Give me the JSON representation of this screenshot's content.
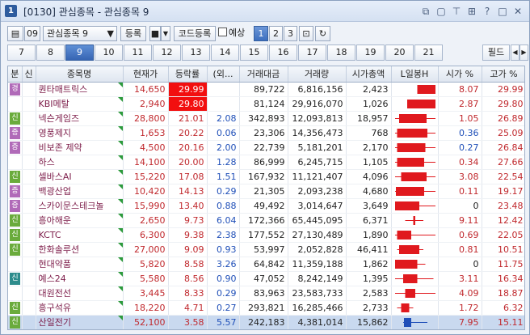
{
  "window": {
    "icon": "1",
    "title": "[0130] 관심종목 - 관심종목 9",
    "buttons": [
      "restore-icon",
      "minimize-icon",
      "pin-icon",
      "grid-icon",
      "help-icon",
      "maximize-icon",
      "close-icon"
    ]
  },
  "toolbar": {
    "group_number": "09",
    "group_name": "관심종목 9",
    "register": "등록",
    "code_register": "코드등록",
    "forecast": "예상",
    "pages": [
      "1",
      "2",
      "3"
    ],
    "active_page": "1"
  },
  "tabs": [
    "7",
    "8",
    "9",
    "10",
    "11",
    "12",
    "13",
    "14",
    "15",
    "16",
    "17",
    "18",
    "19",
    "20",
    "21"
  ],
  "active_tab": "9",
  "field_button": "필드",
  "columns": [
    "분",
    "신",
    "종목명",
    "현재가",
    "등락률",
    "(외...",
    "거래대금",
    "거래량",
    "시가총액",
    "L일봉H",
    "시가 %",
    "고가 %"
  ],
  "colors": {
    "up": "#c0282d",
    "down": "#1f4fb8",
    "hot": "#f20f0f",
    "badge_green": "#6aab3c",
    "badge_purple": "#b06ab8"
  },
  "rows": [
    {
      "badge": "경",
      "badge_color": "p",
      "name": "퀀타매트릭스",
      "price": "14,650",
      "rate": "29.99",
      "hot": true,
      "foreign": "",
      "amount": "89,722",
      "volume": "6,816,156",
      "cap": "2,423",
      "open": "8.07",
      "high": "29.99",
      "open_dir": "up",
      "high_dir": "up",
      "candle": [
        0.55,
        1.0,
        0.55,
        1.0
      ]
    },
    {
      "badge": "",
      "badge_color": "",
      "name": "KBI메탈",
      "price": "2,940",
      "rate": "29.80",
      "hot": true,
      "foreign": "",
      "amount": "81,124",
      "volume": "29,916,070",
      "cap": "1,026",
      "open": "2.87",
      "high": "29.80",
      "open_dir": "up",
      "high_dir": "up",
      "candle": [
        0.3,
        1.0,
        0.3,
        1.0
      ]
    },
    {
      "badge": "신",
      "badge_color": "g",
      "name": "넥슨게임즈",
      "price": "28,800",
      "rate": "21.01",
      "hot": false,
      "foreign": "2.08",
      "amount": "342,893",
      "volume": "12,093,813",
      "cap": "18,957",
      "open": "1.05",
      "high": "26.89",
      "open_dir": "up",
      "high_dir": "up",
      "candle": [
        0.1,
        0.78,
        0.0,
        1.0
      ]
    },
    {
      "badge": "증",
      "badge_color": "p",
      "name": "영풍제지",
      "price": "1,653",
      "rate": "20.22",
      "hot": false,
      "foreign": "0.06",
      "amount": "23,306",
      "volume": "14,356,473",
      "cap": "768",
      "open": "0.36",
      "high": "25.09",
      "open_dir": "down",
      "high_dir": "up",
      "candle": [
        0.05,
        0.8,
        0.0,
        1.0
      ]
    },
    {
      "badge": "증",
      "badge_color": "p",
      "name": "비보존 제약",
      "price": "4,500",
      "rate": "20.16",
      "hot": false,
      "foreign": "2.00",
      "amount": "22,739",
      "volume": "5,181,201",
      "cap": "2,170",
      "open": "0.27",
      "high": "26.84",
      "open_dir": "down",
      "high_dir": "up",
      "candle": [
        0.05,
        0.75,
        0.0,
        1.0
      ]
    },
    {
      "badge": "",
      "badge_color": "",
      "name": "하스",
      "price": "14,100",
      "rate": "20.00",
      "hot": false,
      "foreign": "1.28",
      "amount": "86,999",
      "volume": "6,245,715",
      "cap": "1,105",
      "open": "0.34",
      "high": "27.66",
      "open_dir": "up",
      "high_dir": "up",
      "candle": [
        0.05,
        0.72,
        0.0,
        1.0
      ]
    },
    {
      "badge": "신",
      "badge_color": "g",
      "name": "셀바스AI",
      "price": "15,220",
      "rate": "17.08",
      "hot": false,
      "foreign": "1.51",
      "amount": "167,932",
      "volume": "11,121,407",
      "cap": "4,096",
      "open": "3.08",
      "high": "22.54",
      "open_dir": "up",
      "high_dir": "up",
      "candle": [
        0.15,
        0.78,
        0.0,
        1.0
      ]
    },
    {
      "badge": "증",
      "badge_color": "p",
      "name": "백광산업",
      "price": "10,420",
      "rate": "14.13",
      "hot": false,
      "foreign": "0.29",
      "amount": "21,305",
      "volume": "2,093,238",
      "cap": "4,680",
      "open": "0.11",
      "high": "19.17",
      "open_dir": "up",
      "high_dir": "up",
      "candle": [
        0.02,
        0.72,
        0.0,
        1.0
      ]
    },
    {
      "badge": "증",
      "badge_color": "p",
      "name": "스카이문스테크놀",
      "price": "15,990",
      "rate": "13.40",
      "hot": false,
      "foreign": "0.88",
      "amount": "49,492",
      "volume": "3,014,647",
      "cap": "3,649",
      "open": "0",
      "high": "23.48",
      "open_dir": "none",
      "high_dir": "up",
      "candle": [
        0.0,
        0.6,
        0.0,
        1.0
      ]
    },
    {
      "badge": "신",
      "badge_color": "g",
      "name": "흥아해운",
      "price": "2,650",
      "rate": "9.73",
      "hot": false,
      "foreign": "6.04",
      "amount": "172,366",
      "volume": "65,445,095",
      "cap": "6,371",
      "open": "9.11",
      "high": "12.42",
      "open_dir": "up",
      "high_dir": "up",
      "candle": [
        0.45,
        0.5,
        0.25,
        0.7
      ]
    },
    {
      "badge": "신",
      "badge_color": "g",
      "name": "KCTC",
      "price": "6,300",
      "rate": "9.38",
      "hot": false,
      "foreign": "2.38",
      "amount": "177,552",
      "volume": "27,130,489",
      "cap": "1,890",
      "open": "0.69",
      "high": "22.05",
      "open_dir": "up",
      "high_dir": "up",
      "candle": [
        0.05,
        0.4,
        0.0,
        1.0
      ]
    },
    {
      "badge": "신",
      "badge_color": "g",
      "name": "한화솔루션",
      "price": "27,000",
      "rate": "9.09",
      "hot": false,
      "foreign": "0.93",
      "amount": "53,997",
      "volume": "2,052,828",
      "cap": "46,411",
      "open": "0.81",
      "high": "10.51",
      "open_dir": "up",
      "high_dir": "up",
      "candle": [
        0.1,
        0.6,
        0.05,
        0.7
      ]
    },
    {
      "badge": "",
      "badge_color": "",
      "name": "현대약품",
      "price": "5,820",
      "rate": "8.58",
      "hot": false,
      "foreign": "3.26",
      "amount": "64,842",
      "volume": "11,359,188",
      "cap": "1,862",
      "open": "0",
      "high": "11.75",
      "open_dir": "none",
      "high_dir": "up",
      "candle": [
        0.0,
        0.55,
        0.0,
        0.75
      ]
    },
    {
      "badge": "신",
      "badge_color": "t",
      "name": "예스24",
      "price": "5,580",
      "rate": "8.56",
      "hot": false,
      "foreign": "0.90",
      "amount": "47,052",
      "volume": "8,242,149",
      "cap": "1,395",
      "open": "3.11",
      "high": "16.34",
      "open_dir": "up",
      "high_dir": "up",
      "candle": [
        0.2,
        0.55,
        0.0,
        0.95
      ]
    },
    {
      "badge": "",
      "badge_color": "",
      "name": "대원전선",
      "price": "3,445",
      "rate": "8.33",
      "hot": false,
      "foreign": "0.29",
      "amount": "83,963",
      "volume": "23,583,733",
      "cap": "2,583",
      "open": "4.09",
      "high": "18.87",
      "open_dir": "up",
      "high_dir": "up",
      "candle": [
        0.25,
        0.5,
        0.0,
        1.0
      ]
    },
    {
      "badge": "신",
      "badge_color": "g",
      "name": "흥구석유",
      "price": "18,220",
      "rate": "4.71",
      "hot": false,
      "foreign": "0.27",
      "amount": "293,821",
      "volume": "16,285,466",
      "cap": "2,733",
      "open": "1.72",
      "high": "6.32",
      "open_dir": "up",
      "high_dir": "up",
      "candle": [
        0.15,
        0.35,
        0.05,
        0.45
      ]
    },
    {
      "badge": "신",
      "badge_color": "g",
      "name": "산일전기",
      "price": "52,100",
      "rate": "3.58",
      "hot": false,
      "foreign": "5.57",
      "amount": "242,183",
      "volume": "4,381,014",
      "cap": "15,862",
      "open": "7.95",
      "high": "15.11",
      "open_dir": "up",
      "high_dir": "up",
      "candle": [
        0.4,
        0.22,
        0.2,
        0.8
      ],
      "selected": true
    }
  ]
}
